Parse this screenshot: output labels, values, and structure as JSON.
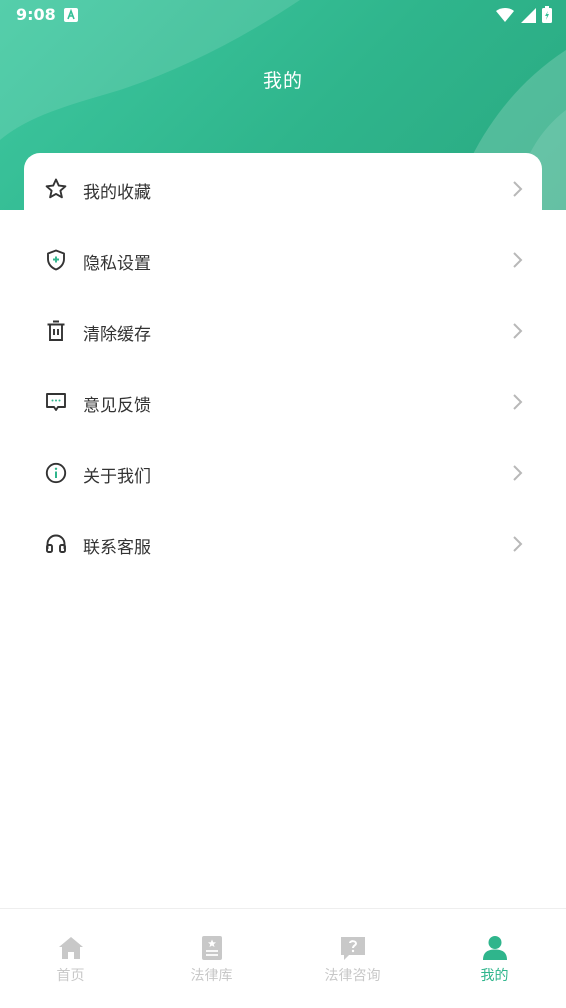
{
  "status_bar": {
    "time": "9:08"
  },
  "header": {
    "title": "我的"
  },
  "menu": [
    {
      "label": "我的收藏",
      "icon": "star-icon"
    },
    {
      "label": "隐私设置",
      "icon": "shield-icon"
    },
    {
      "label": "清除缓存",
      "icon": "trash-icon"
    },
    {
      "label": "意见反馈",
      "icon": "message-icon"
    },
    {
      "label": "关于我们",
      "icon": "info-icon"
    },
    {
      "label": "联系客服",
      "icon": "headset-icon"
    }
  ],
  "tabs": [
    {
      "label": "首页",
      "icon": "home-icon",
      "active": false
    },
    {
      "label": "法律库",
      "icon": "book-icon",
      "active": false
    },
    {
      "label": "法律咨询",
      "icon": "question-icon",
      "active": false
    },
    {
      "label": "我的",
      "icon": "user-icon",
      "active": true
    }
  ],
  "colors": {
    "accent": "#2fb58c",
    "inactive": "#c8c8c8",
    "text": "#333333"
  }
}
